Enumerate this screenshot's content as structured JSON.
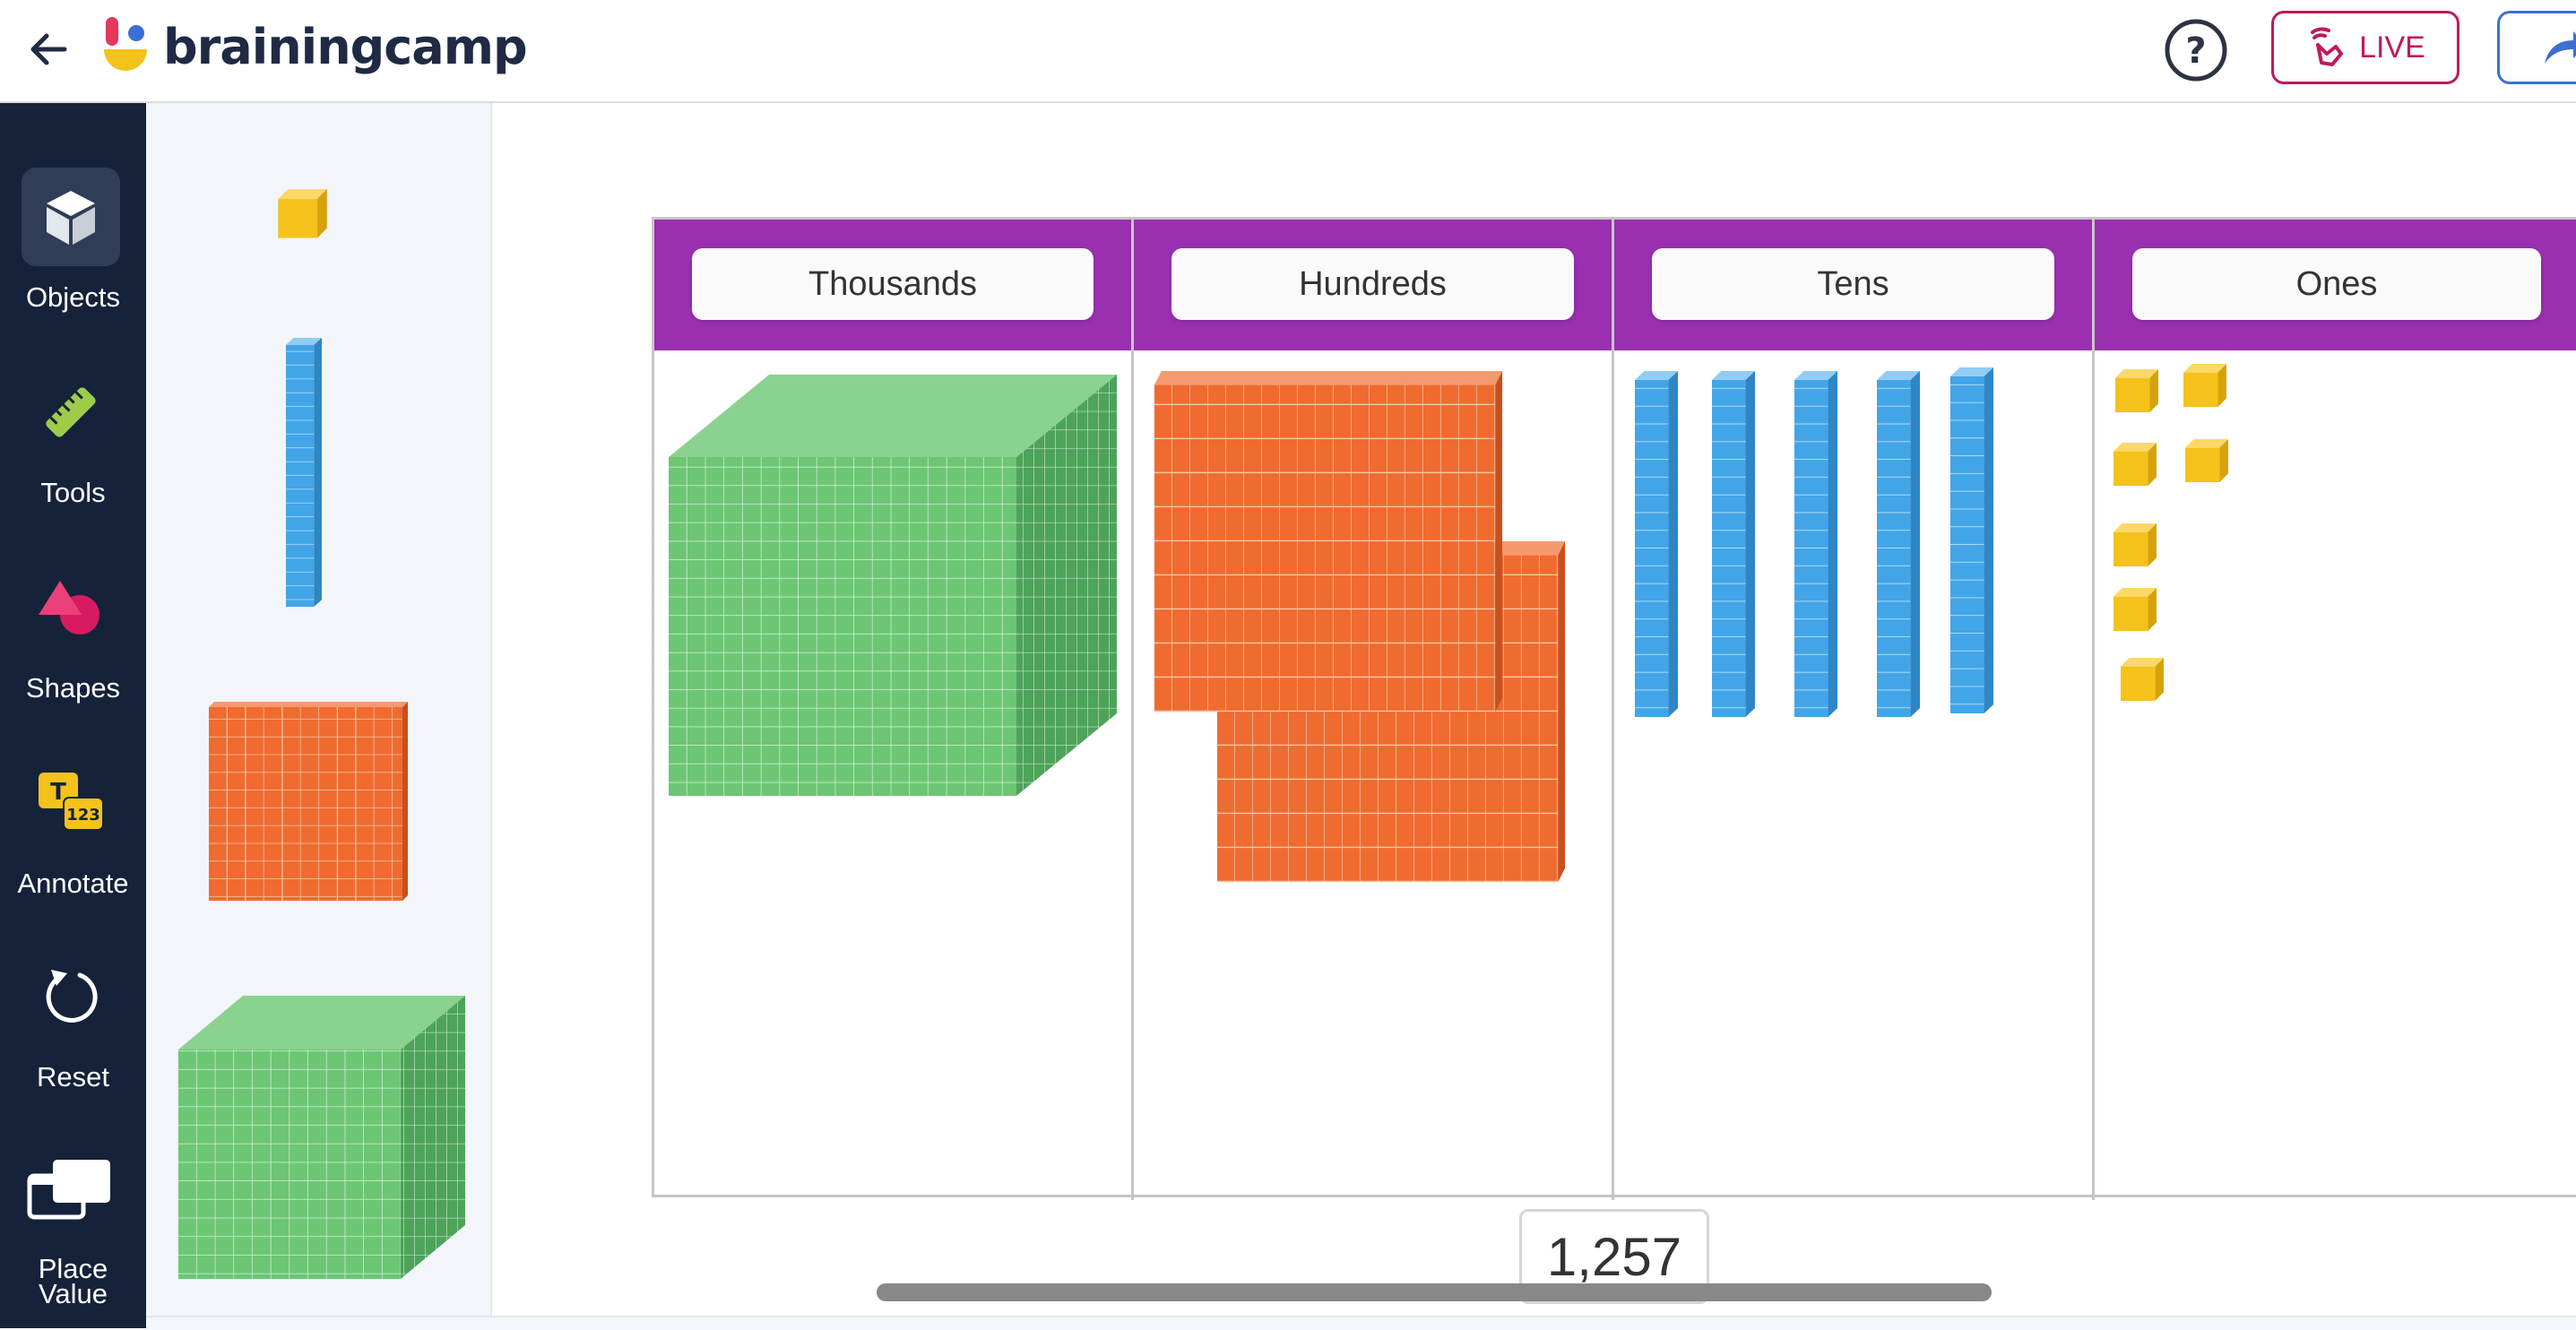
{
  "header": {
    "brand": "brainingcamp",
    "live_label": "LIVE",
    "icons": {
      "back": "arrow-left-icon",
      "help": "question-circle-icon",
      "live": "broadcast-hand-icon",
      "share": "share-arrow-icon"
    }
  },
  "nav": {
    "items": [
      {
        "label": "Objects",
        "icon": "cube-icon",
        "active": true
      },
      {
        "label": "Tools",
        "icon": "ruler-icon",
        "active": false
      },
      {
        "label": "Shapes",
        "icon": "shapes-icon",
        "active": false
      },
      {
        "label": "Annotate",
        "icon": "text-number-icon",
        "active": false
      },
      {
        "label": "Reset",
        "icon": "reset-icon",
        "active": false
      },
      {
        "label": "Place",
        "label2": "Value",
        "icon": "place-value-icon",
        "active": false
      }
    ]
  },
  "palette": {
    "items": [
      "one-unit-cube",
      "ten-rod",
      "hundred-flat",
      "thousand-cube"
    ]
  },
  "place_value": {
    "columns": [
      "Thousands",
      "Hundreds",
      "Tens",
      "Ones"
    ],
    "counts": {
      "thousands": 1,
      "hundreds": 2,
      "tens": 5,
      "ones": 7
    },
    "total": "1,257"
  },
  "colors": {
    "header_purple": "#9a2fb0",
    "nav_bg": "#15223a",
    "unit_yellow": "#f5c21b",
    "rod_blue": "#42a5e8",
    "flat_orange": "#ef6b30",
    "cube_green": "#6cc674",
    "live_red": "#c2185b"
  }
}
